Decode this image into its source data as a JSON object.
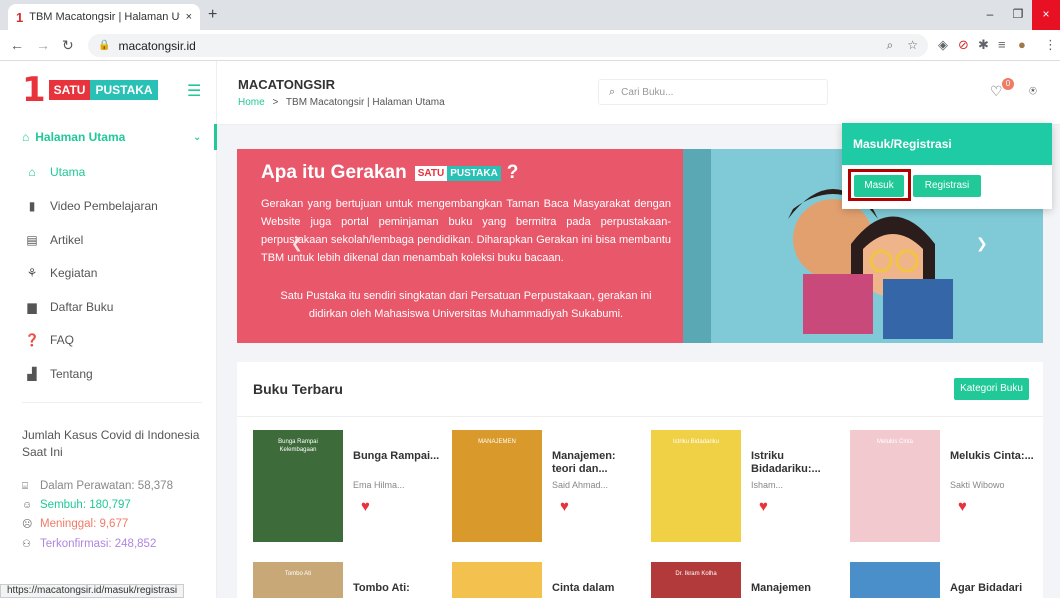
{
  "browser": {
    "tab_title": "TBM Macatongsir | Halaman Uta",
    "tab_close": "×",
    "new_tab": "+",
    "url": "macatongsir.id",
    "status_url": "https://macatongsir.id/masuk/registrasi",
    "win_min": "–",
    "win_max": "❐",
    "win_close": "×"
  },
  "sidebar": {
    "logo_one": "1",
    "logo_satu": "SATU",
    "logo_pustaka": "PUSTAKA",
    "menu_head": "Halaman Utama",
    "items": [
      {
        "label": "Utama",
        "icon": "⌂"
      },
      {
        "label": "Video Pembelajaran",
        "icon": "▮"
      },
      {
        "label": "Artikel",
        "icon": "▤"
      },
      {
        "label": "Kegiatan",
        "icon": "⚘"
      },
      {
        "label": "Daftar Buku",
        "icon": "▆"
      },
      {
        "label": "FAQ",
        "icon": "❓"
      },
      {
        "label": "Tentang",
        "icon": "▟"
      }
    ],
    "covid_title": "Jumlah Kasus Covid di Indonesia Saat Ini",
    "covid": [
      {
        "label": "Dalam Perawatan: 58,378",
        "color": "#888888"
      },
      {
        "label": "Sembuh: 180,797",
        "color": "#20c997"
      },
      {
        "label": "Meninggal: 9,677",
        "color": "#f07b66"
      },
      {
        "label": "Terkonfirmasi: 248,852",
        "color": "#b085e0"
      }
    ]
  },
  "header": {
    "site_name": "MACATONGSIR",
    "crumb_home": "Home",
    "crumb_sep": ">",
    "crumb_current": "TBM Macatongsir | Halaman Utama",
    "search_placeholder": "Cari Buku...",
    "wishlist_count": "0"
  },
  "banner": {
    "title": "Apa itu Gerakan",
    "title_satu": "SATU",
    "title_pustaka": "PUSTAKA",
    "title_q": "?",
    "text1": "Gerakan yang bertujuan untuk mengembangkan Taman Baca Masyarakat dengan Website juga portal peminjaman buku yang bermitra pada perpustakaan-perpustakaan sekolah/lembaga pendidikan. Diharapkan Gerakan ini bisa membantu TBM untuk lebih dikenal dan menambah koleksi buku bacaan.",
    "text2": "Satu Pustaka itu sendiri singkatan dari Persatuan Perpustakaan, gerakan ini didirkan oleh Mahasiswa Universitas Muhammadiyah Sukabumi."
  },
  "popup": {
    "title": "Masuk/Registrasi",
    "masuk": "Masuk",
    "registrasi": "Registrasi"
  },
  "books": {
    "title": "Buku Terbaru",
    "kategori": "Kategori Buku",
    "items": [
      {
        "title": "Bunga Rampai...",
        "author": "Ema Hilma...",
        "cover": "Bunga Rampai Kelembagaan",
        "color": "#3d6b3a"
      },
      {
        "title": "Manajemen: teori dan...",
        "author": "Said Ahmad...",
        "cover": "MANAJEMEN",
        "color": "#d99a2b"
      },
      {
        "title": "Istriku Bidadariku:...",
        "author": "Isham...",
        "cover": "Istriku Bidadariku",
        "color": "#f0d044"
      },
      {
        "title": "Melukis Cinta:...",
        "author": "Sakti Wibowo",
        "cover": "Melukis Cinta",
        "color": "#f3c9d0"
      },
      {
        "title": "Tombo Ati:",
        "author": "",
        "cover": "Tombo Ati",
        "color": "#c9a878"
      },
      {
        "title": "Cinta dalam",
        "author": "",
        "cover": "",
        "color": "#f2c14e"
      },
      {
        "title": "Manajemen",
        "author": "",
        "cover": "Dr. Ikram Kolha",
        "color": "#b33a3a"
      },
      {
        "title": "Agar Bidadari",
        "author": "",
        "cover": "",
        "color": "#4a8fc9"
      }
    ]
  }
}
